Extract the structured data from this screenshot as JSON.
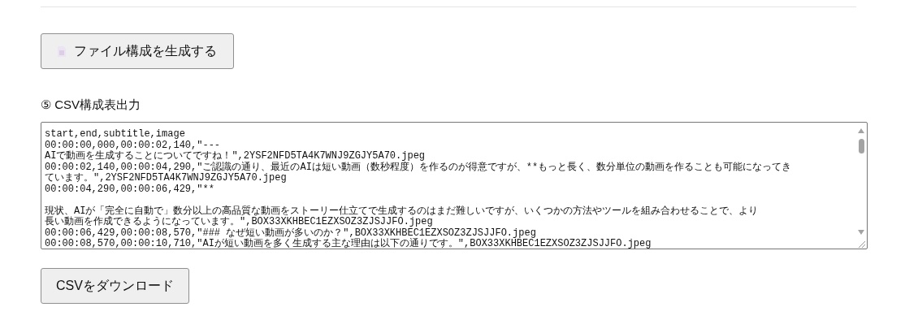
{
  "generate_button": {
    "label": "ファイル構成を生成する"
  },
  "section_title": "⑤ CSV構成表出力",
  "csv_output": {
    "lines": [
      {
        "text": "start,end,subtitle,image",
        "gap_before": false
      },
      {
        "text": "00:00:00,000,00:00:02,140,\"---",
        "gap_before": false
      },
      {
        "text": "AIで動画を生成することについてですね！\",2YSF2NFD5TA4K7WNJ9ZGJY5A70.jpeg",
        "gap_before": false
      },
      {
        "text": "00:00:02,140,00:00:04,290,\"ご認識の通り、最近のAIは短い動画（数秒程度）を作るのが得意ですが、**もっと長く、数分単位の動画を作ることも可能になってき",
        "gap_before": false
      },
      {
        "text": "ています。\",2YSF2NFD5TA4K7WNJ9ZGJY5A70.jpeg",
        "gap_before": false
      },
      {
        "text": "00:00:04,290,00:00:06,429,\"**",
        "gap_before": false
      },
      {
        "text": "現状、AIが「完全に自動で」数分以上の高品質な動画をストーリー仕立てで生成するのはまだ難しいですが、いくつかの方法やツールを組み合わせることで、より",
        "gap_before": true
      },
      {
        "text": "長い動画を作成できるようになっています。\",BOX33XKHBEC1EZXSOZ3ZJSJJFO.jpeg",
        "gap_before": false
      },
      {
        "text": "00:00:06,429,00:00:08,570,\"### なぜ短い動画が多いのか？\",BOX33XKHBEC1EZXSOZ3ZJSJJFO.jpeg",
        "gap_before": false
      },
      {
        "text": "00:00:08,570,00:00:10,710,\"AIが短い動画を多く生成する主な理由は以下の通りです。\",BOX33XKHBEC1EZXSOZ3ZJSJJFO.jpeg",
        "gap_before": false
      }
    ]
  },
  "download_button": {
    "label": "CSVをダウンロード"
  }
}
